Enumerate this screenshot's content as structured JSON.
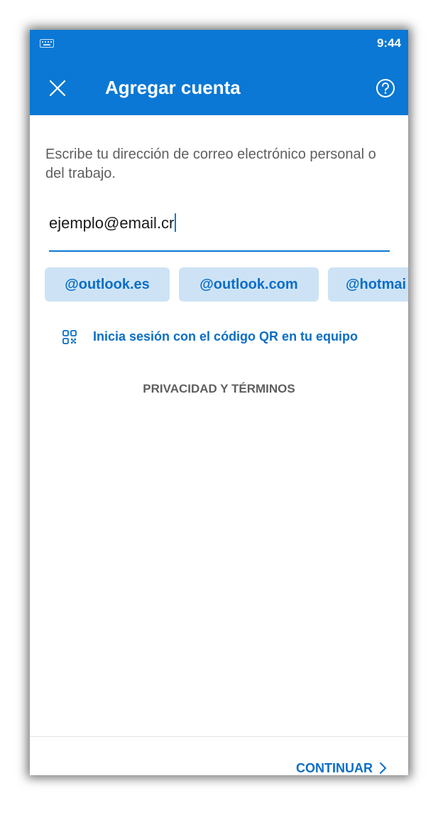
{
  "status_bar": {
    "time": "9:44",
    "left_icon": "keyboard-icon"
  },
  "app_bar": {
    "title": "Agregar cuenta",
    "close_icon": "close-icon",
    "help_icon": "help-icon",
    "background": "#0a78d4"
  },
  "form": {
    "instruction": "Escribe tu dirección de correo electrónico personal o del trabajo.",
    "email_value": "ejemplo@email.cr"
  },
  "suggestions": [
    "@outlook.es",
    "@outlook.com",
    "@hotmai"
  ],
  "qr_login": {
    "icon": "qr-code-icon",
    "label": "Inicia sesión con el código QR en tu equipo"
  },
  "privacy_label": "PRIVACIDAD Y TÉRMINOS",
  "footer": {
    "continue_label": "CONTINUAR",
    "continue_icon": "chevron-right-icon"
  },
  "colors": {
    "accent": "#0a78d4",
    "link": "#0a6ec7",
    "chip_bg": "#cde3f5"
  }
}
